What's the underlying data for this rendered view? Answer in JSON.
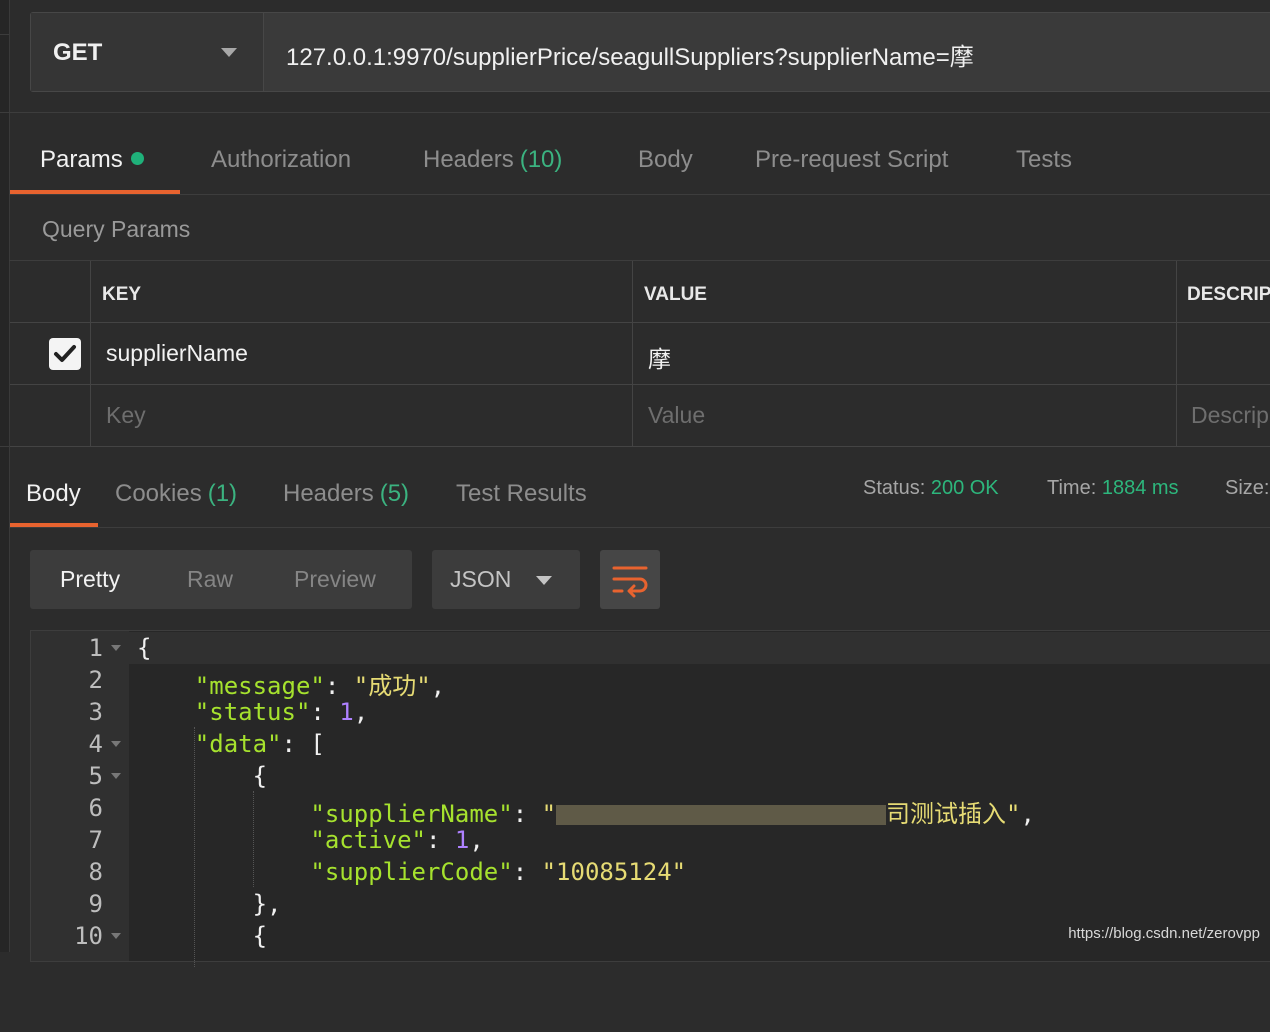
{
  "request": {
    "method": "GET",
    "url": "127.0.0.1:9970/supplierPrice/seagullSuppliers?supplierName=摩"
  },
  "request_tabs": [
    {
      "label": "Params",
      "active": true,
      "has_dot": true
    },
    {
      "label": "Authorization"
    },
    {
      "label": "Headers",
      "count": "(10)"
    },
    {
      "label": "Body"
    },
    {
      "label": "Pre-request Script"
    },
    {
      "label": "Tests"
    }
  ],
  "query_params": {
    "title": "Query Params",
    "columns": [
      "KEY",
      "VALUE",
      "DESCRIPT"
    ],
    "rows": [
      {
        "checked": true,
        "key": "supplierName",
        "value": "摩",
        "description": ""
      }
    ],
    "placeholders": {
      "key": "Key",
      "value": "Value",
      "description": "Descrip"
    }
  },
  "response_tabs": [
    {
      "label": "Body",
      "active": true
    },
    {
      "label": "Cookies",
      "count": "(1)"
    },
    {
      "label": "Headers",
      "count": "(5)"
    },
    {
      "label": "Test Results"
    }
  ],
  "response_status": {
    "status_label": "Status:",
    "status_value": "200 OK",
    "time_label": "Time:",
    "time_value": "1884 ms",
    "size_label": "Size:"
  },
  "body_view": {
    "modes": [
      "Pretty",
      "Raw",
      "Preview"
    ],
    "active_mode": "Pretty",
    "format": "JSON"
  },
  "code": {
    "line_numbers": [
      "1",
      "2",
      "3",
      "4",
      "5",
      "6",
      "7",
      "8",
      "9",
      "10"
    ],
    "brace_open": "{",
    "message_key": "\"message\"",
    "message_value": "\"成功\"",
    "status_key": "\"status\"",
    "status_value": "1",
    "data_key": "\"data\"",
    "supplier_name_key": "\"supplierName\"",
    "supplier_name_visible_tail": "司测试插入\"",
    "active_key": "\"active\"",
    "active_value": "1",
    "supplier_code_key": "\"supplierCode\"",
    "supplier_code_value": "\"10085124\"",
    "close_obj": "},",
    "open_obj": "{"
  },
  "watermark": "https://blog.csdn.net/zerovpp",
  "colors": {
    "accent": "#e8632f",
    "success": "#2db67c",
    "json_key": "#a6e22e",
    "json_string": "#e6db74",
    "json_number": "#ae81ff"
  }
}
